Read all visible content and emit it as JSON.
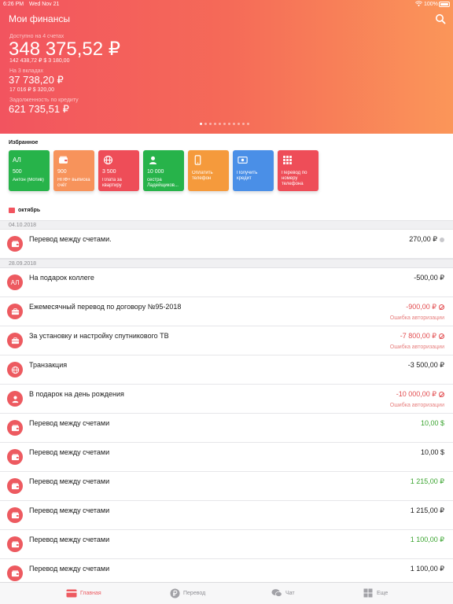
{
  "status_bar": {
    "time": "6:26 PM",
    "date": "Wed Nov 21",
    "battery": "100%"
  },
  "header": {
    "title": "Мои финансы"
  },
  "accounts": {
    "available": {
      "caption": "Доступно на 4 счетах",
      "amount": "348 375,52 ₽",
      "sub": "142 438,72 ₽   $ 3 180,00"
    },
    "deposits": {
      "caption": "На 3 вкладах",
      "amount": "37 738,20 ₽",
      "sub": "17 016 ₽   $ 320,00"
    },
    "credit": {
      "caption": "Задолженность по кредиту",
      "amount": "621 735,51 ₽"
    }
  },
  "pager": {
    "pages": 11,
    "active": 1
  },
  "favourites": {
    "title": "Избранное",
    "items": [
      {
        "icon": "initials-badge",
        "glyph": "АЛ",
        "value": "500",
        "name": "Антон (Мотив)",
        "color": "#27b34a"
      },
      {
        "icon": "wallet-icon",
        "value": "900",
        "name": "НПФ+ выписка счёт",
        "color": "#f7935b"
      },
      {
        "icon": "globe-icon",
        "value": "3 500",
        "name": "Плата за квартиру",
        "color": "#ee4d58"
      },
      {
        "icon": "person-icon",
        "value": "10 000",
        "name": "сестра Ладейщиков...",
        "color": "#27b34a"
      },
      {
        "icon": "phone-icon",
        "value": "",
        "name": "Оплатить телефон",
        "color": "#f59a3c"
      },
      {
        "icon": "cash-icon",
        "value": "",
        "name": "Получить кредит",
        "color": "#4a8fe7"
      },
      {
        "icon": "keypad-icon",
        "value": "",
        "name": "Перевод по номеру телефона",
        "color": "#ee4d58"
      }
    ]
  },
  "month": {
    "label": "октябрь"
  },
  "groups": [
    {
      "date": "04.10.2018",
      "items": [
        {
          "icon": "wallet-icon",
          "title": "Перевод между счетами.",
          "amount": "270,00 ₽",
          "state": "neutral",
          "marker": "pending-dot"
        }
      ]
    },
    {
      "date": "28.09.2018",
      "items": [
        {
          "icon": "initials-avatar",
          "initials": "АЛ",
          "title": "На подарок коллеге",
          "amount": "-500,00 ₽",
          "state": "neutral"
        },
        {
          "icon": "briefcase-icon",
          "title": "Ежемесячный перевод по договору №95-2018",
          "amount": "-900,00 ₽",
          "state": "error",
          "marker": "blocked-icon",
          "note": "Ошибка авторизации"
        },
        {
          "icon": "briefcase-icon",
          "title": "За установку и настройку спутникового ТВ",
          "amount": "-7 800,00 ₽",
          "state": "error",
          "marker": "blocked-icon",
          "note": "Ошибка авторизации"
        },
        {
          "icon": "globe-icon",
          "title": "Транзакция",
          "amount": "-3 500,00 ₽",
          "state": "neutral"
        },
        {
          "icon": "person-icon",
          "title": "В подарок на день рождения",
          "amount": "-10 000,00 ₽",
          "state": "error",
          "marker": "blocked-icon",
          "note": "Ошибка авторизации"
        },
        {
          "icon": "wallet-icon",
          "title": "Перевод между счетами",
          "amount": "10,00 $",
          "state": "positive"
        },
        {
          "icon": "wallet-icon",
          "title": "Перевод между счетами",
          "amount": "10,00 $",
          "state": "neutral"
        },
        {
          "icon": "wallet-icon",
          "title": "Перевод между счетами",
          "amount": "1 215,00 ₽",
          "state": "positive"
        },
        {
          "icon": "wallet-icon",
          "title": "Перевод между счетами",
          "amount": "1 215,00 ₽",
          "state": "neutral"
        },
        {
          "icon": "wallet-icon",
          "title": "Перевод между счетами",
          "amount": "1 100,00 ₽",
          "state": "positive"
        },
        {
          "icon": "wallet-icon",
          "title": "Перевод между счетами",
          "amount": "1 100,00 ₽",
          "state": "neutral"
        }
      ]
    }
  ],
  "tabbar": {
    "items": [
      {
        "icon": "card-icon",
        "label": "Главная",
        "active": true
      },
      {
        "icon": "ruble-coin-icon",
        "label": "Перевод",
        "active": false
      },
      {
        "icon": "chat-icon",
        "label": "Чат",
        "active": false
      },
      {
        "icon": "grid-icon",
        "label": "Еще",
        "active": false
      }
    ]
  }
}
